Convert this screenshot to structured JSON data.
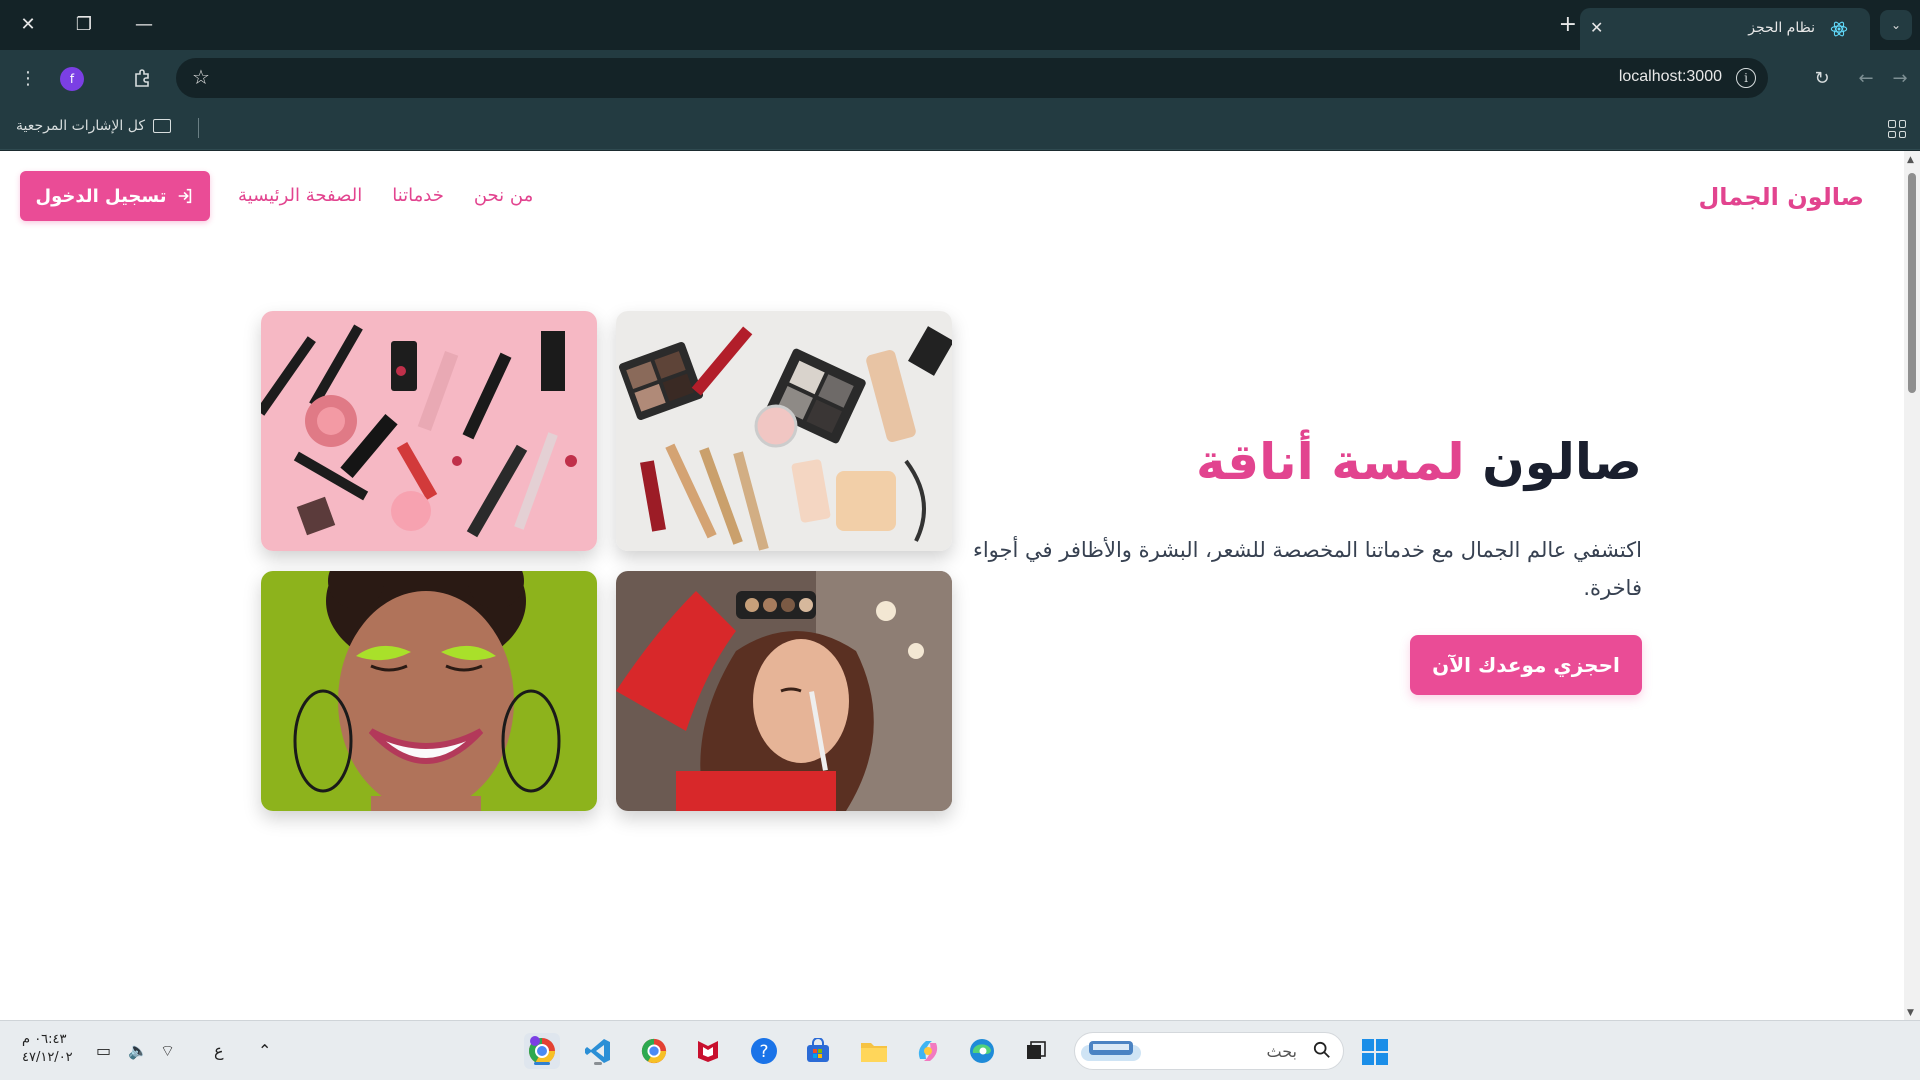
{
  "browser": {
    "tab_title": "نظام الحجز",
    "url": "localhost:3000",
    "profile_initial": "f",
    "bookmarks_label": "كل الإشارات المرجعية"
  },
  "site": {
    "brand": "صالون الجمال",
    "nav": [
      "الصفحة الرئيسية",
      "خدماتنا",
      "من نحن"
    ],
    "login_label": "تسجيل الدخول"
  },
  "hero": {
    "title_main": "صالون",
    "title_accent": "لمسة أناقة",
    "description": "اكتشفي عالم الجمال مع خدماتنا المخصصة للشعر، البشرة والأظافر في أجواء فاخرة.",
    "cta_label": "احجزي موعدك الآن"
  },
  "images": [
    "makeup-flatlay-neutral",
    "makeup-flatlay-pink",
    "makeup-artist-applying",
    "woman-green-eyeshadow"
  ],
  "taskbar": {
    "search_placeholder": "بحث",
    "time": "٠٦:٤٣ م",
    "date": "٤٧/١٢/٠٢",
    "lang": "ع"
  },
  "colors": {
    "accent": "#e2448f",
    "button": "#ea4c96"
  }
}
